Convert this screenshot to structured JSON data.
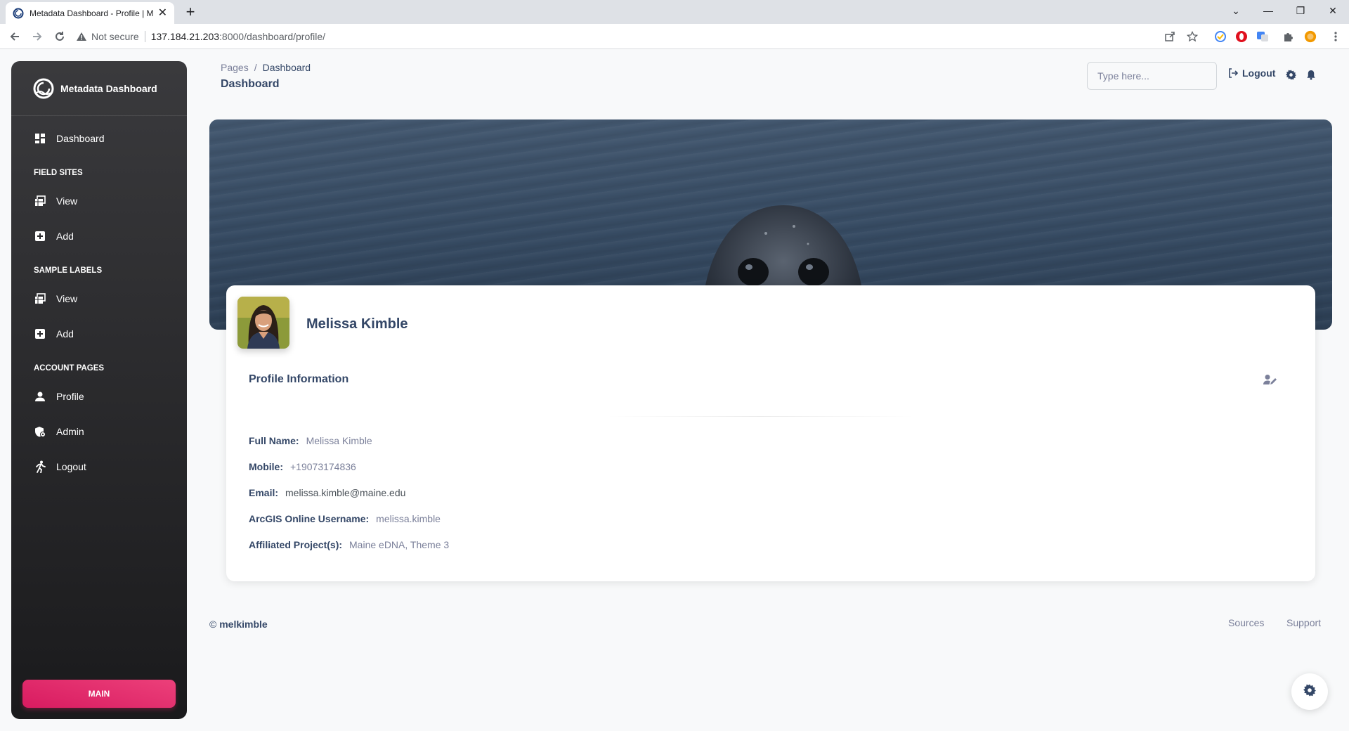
{
  "browser": {
    "tab_title": "Metadata Dashboard - Profile | M",
    "security_label": "Not secure",
    "url_host": "137.184.21.203",
    "url_path": ":8000/dashboard/profile/"
  },
  "sidebar": {
    "brand": "Metadata Dashboard",
    "dashboard_label": "Dashboard",
    "sections": {
      "field_sites": "FIELD SITES",
      "sample_labels": "SAMPLE LABELS",
      "account_pages": "ACCOUNT PAGES"
    },
    "field_sites": {
      "view": "View",
      "add": "Add"
    },
    "sample_labels": {
      "view": "View",
      "add": "Add"
    },
    "account": {
      "profile": "Profile",
      "admin": "Admin",
      "logout": "Logout"
    },
    "main_button": "MAIN"
  },
  "navbar": {
    "breadcrumb_root": "Pages",
    "breadcrumb_sep": "/",
    "breadcrumb_current": "Dashboard",
    "page_title": "Dashboard",
    "search_placeholder": "Type here...",
    "logout_label": "Logout"
  },
  "profile": {
    "name": "Melissa Kimble",
    "info_title": "Profile Information",
    "fields": [
      {
        "label": "Full Name:",
        "value": "Melissa Kimble"
      },
      {
        "label": "Mobile:",
        "value": "+19073174836"
      },
      {
        "label": "Email:",
        "value": "melissa.kimble@maine.edu"
      },
      {
        "label": "ArcGIS Online Username:",
        "value": "melissa.kimble"
      },
      {
        "label": "Affiliated Project(s):",
        "value": "Maine eDNA, Theme 3"
      }
    ]
  },
  "footer": {
    "copyright_symbol": "©",
    "author": "melkimble",
    "links": [
      "Sources",
      "Support"
    ]
  },
  "colors": {
    "accent": "#e91e63",
    "sidebar_dark": "#1a1a1c",
    "text_primary": "#344767",
    "text_secondary": "#7b809a"
  }
}
